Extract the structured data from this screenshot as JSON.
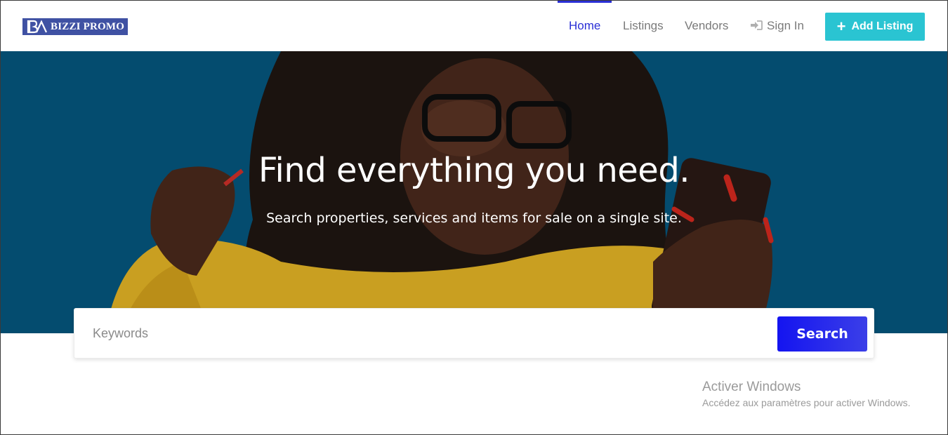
{
  "brand": {
    "name": "BIZZI PROMO",
    "logo_color": "#3f51a3"
  },
  "nav": {
    "items": [
      {
        "label": "Home",
        "active": true
      },
      {
        "label": "Listings",
        "active": false
      },
      {
        "label": "Vendors",
        "active": false
      },
      {
        "label": "Sign In",
        "active": false,
        "icon": "sign-in-icon"
      }
    ],
    "add_listing": {
      "label": "Add Listing",
      "icon": "plus-icon",
      "color": "#2ac4d2"
    },
    "accent": "#2a2fd6"
  },
  "hero": {
    "title": "Find everything you need.",
    "subtitle": "Search properties, services and items for sale on a single site.",
    "background": "#05577f"
  },
  "search": {
    "placeholder": "Keywords",
    "value": "",
    "button_label": "Search",
    "button_color": "#1414f0"
  },
  "watermark": {
    "title": "Activer Windows",
    "subtitle": "Accédez aux paramètres pour activer Windows."
  }
}
